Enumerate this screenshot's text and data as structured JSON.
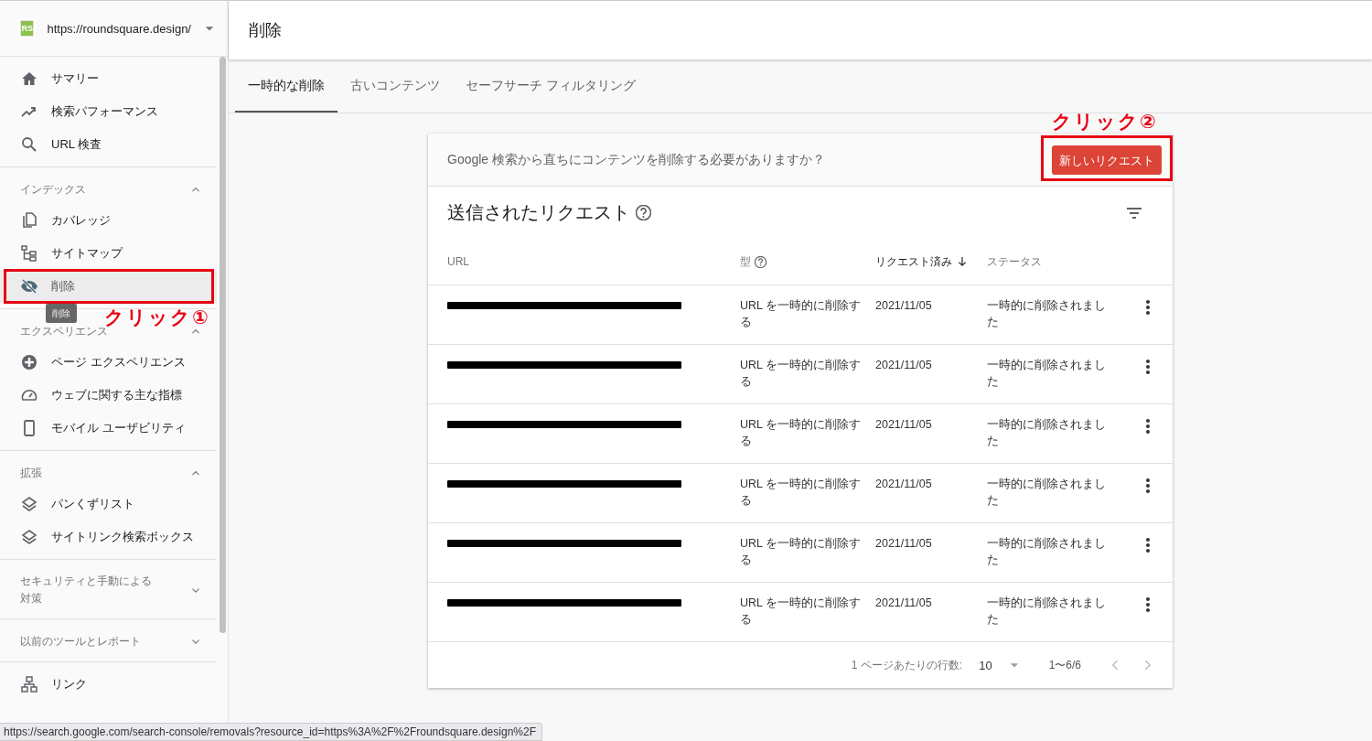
{
  "site": {
    "logo": "RS",
    "url": "https://roundsquare.design/"
  },
  "sidebar": {
    "groups": [
      {
        "items": [
          {
            "label": "サマリー",
            "kind": "home",
            "selected": false
          },
          {
            "label": "検索パフォーマンス",
            "kind": "trend",
            "selected": false
          },
          {
            "label": "URL 検査",
            "kind": "search",
            "selected": false
          }
        ]
      },
      {
        "heading": "インデックス",
        "expanded": true,
        "items": [
          {
            "label": "カバレッジ",
            "kind": "copy",
            "selected": false
          },
          {
            "label": "サイトマップ",
            "kind": "sitemap",
            "selected": false
          },
          {
            "label": "削除",
            "kind": "eye-off",
            "selected": true,
            "tooltip": "削除",
            "annotation": "クリック①"
          }
        ]
      },
      {
        "heading": "エクスペリエンス",
        "expanded": true,
        "items": [
          {
            "label": "ページ エクスペリエンス",
            "kind": "plus-circle",
            "selected": false
          },
          {
            "label": "ウェブに関する主な指標",
            "kind": "gauge",
            "selected": false
          },
          {
            "label": "モバイル ユーザビリティ",
            "kind": "phone",
            "selected": false
          }
        ]
      },
      {
        "heading": "拡張",
        "expanded": true,
        "items": [
          {
            "label": "パンくずリスト",
            "kind": "layers",
            "selected": false
          },
          {
            "label": "サイトリンク検索ボックス",
            "kind": "layers",
            "selected": false
          }
        ]
      },
      {
        "heading": "セキュリティと手動による対策",
        "expanded": false
      },
      {
        "heading": "以前のツールとレポート",
        "expanded": false
      },
      {
        "items": [
          {
            "label": "リンク",
            "kind": "network",
            "selected": false
          }
        ]
      }
    ]
  },
  "page_title": "削除",
  "tabs": [
    {
      "label": "一時的な削除",
      "selected": true
    },
    {
      "label": "古いコンテンツ",
      "selected": false
    },
    {
      "label": "セーフサーチ フィルタリング",
      "selected": false
    }
  ],
  "card": {
    "prompt": "Google 検索から直ちにコンテンツを削除する必要がありますか？",
    "button": {
      "label": "新しいリクエスト",
      "annotation": "クリック②"
    },
    "title": "送信されたリクエスト",
    "columns": [
      {
        "label": "URL",
        "help": false,
        "sorted": false
      },
      {
        "label": "型",
        "help": true,
        "sorted": false
      },
      {
        "label": "リクエスト済み",
        "help": false,
        "sorted": true
      },
      {
        "label": "ステータス",
        "help": false,
        "sorted": false
      }
    ],
    "rows": [
      {
        "url_redacted": true,
        "type": "URL を一時的に削除する",
        "date": "2021/11/05",
        "status": "一時的に削除されました"
      },
      {
        "url_redacted": true,
        "type": "URL を一時的に削除する",
        "date": "2021/11/05",
        "status": "一時的に削除されました"
      },
      {
        "url_redacted": true,
        "type": "URL を一時的に削除する",
        "date": "2021/11/05",
        "status": "一時的に削除されました"
      },
      {
        "url_redacted": true,
        "type": "URL を一時的に削除する",
        "date": "2021/11/05",
        "status": "一時的に削除されました"
      },
      {
        "url_redacted": true,
        "type": "URL を一時的に削除する",
        "date": "2021/11/05",
        "status": "一時的に削除されました"
      },
      {
        "url_redacted": true,
        "type": "URL を一時的に削除する",
        "date": "2021/11/05",
        "status": "一時的に削除されました"
      }
    ],
    "footer": {
      "rows_per_page_label": "1 ページあたりの行数:",
      "rows_per_page": "10",
      "range": "1〜6/6"
    }
  },
  "status_bar": "https://search.google.com/search-console/removals?resource_id=https%3A%2F%2Froundsquare.design%2F"
}
